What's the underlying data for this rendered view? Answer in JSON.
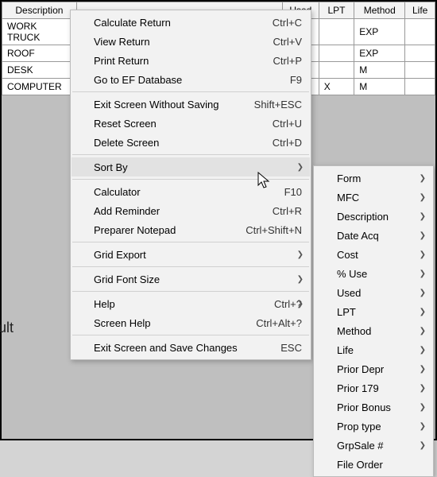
{
  "grid": {
    "headers": [
      "Description",
      "Used",
      "LPT",
      "Method",
      "Life"
    ],
    "rows": [
      {
        "desc": "WORK TRUCK",
        "used": "",
        "lpt": "",
        "method": "EXP",
        "life": ""
      },
      {
        "desc": "ROOF",
        "used": "",
        "lpt": "",
        "method": "EXP",
        "life": ""
      },
      {
        "desc": "DESK",
        "used": "",
        "lpt": "",
        "method": "M",
        "life": ""
      },
      {
        "desc": "COMPUTER",
        "used": "",
        "lpt": "X",
        "method": "M",
        "life": ""
      }
    ]
  },
  "sidebar_fragment": "ult",
  "main_menu": [
    {
      "label": "Calculate Return",
      "shortcut": "Ctrl+C"
    },
    {
      "label": "View Return",
      "shortcut": "Ctrl+V"
    },
    {
      "label": "Print Return",
      "shortcut": "Ctrl+P"
    },
    {
      "label": "Go to EF Database",
      "shortcut": "F9"
    },
    {
      "sep": true
    },
    {
      "label": "Exit Screen Without Saving",
      "shortcut": "Shift+ESC"
    },
    {
      "label": "Reset Screen",
      "shortcut": "Ctrl+U"
    },
    {
      "label": "Delete Screen",
      "shortcut": "Ctrl+D"
    },
    {
      "sep": true
    },
    {
      "label": "Sort By",
      "shortcut": "",
      "submenu": true,
      "hover": true
    },
    {
      "sep": true
    },
    {
      "label": "Calculator",
      "shortcut": "F10"
    },
    {
      "label": "Add Reminder",
      "shortcut": "Ctrl+R"
    },
    {
      "label": "Preparer Notepad",
      "shortcut": "Ctrl+Shift+N"
    },
    {
      "sep": true
    },
    {
      "label": "Grid Export",
      "shortcut": "",
      "submenu": true
    },
    {
      "sep": true
    },
    {
      "label": "Grid Font Size",
      "shortcut": "",
      "submenu": true
    },
    {
      "sep": true
    },
    {
      "label": "Help",
      "shortcut": "Ctrl+?",
      "submenu": true
    },
    {
      "label": "Screen Help",
      "shortcut": "Ctrl+Alt+?"
    },
    {
      "sep": true
    },
    {
      "label": "Exit Screen and Save Changes",
      "shortcut": "ESC"
    }
  ],
  "sub_menu": [
    {
      "label": "Form",
      "submenu": true
    },
    {
      "label": "MFC",
      "submenu": true
    },
    {
      "label": "Description",
      "submenu": true
    },
    {
      "label": "Date Acq",
      "submenu": true
    },
    {
      "label": "Cost",
      "submenu": true
    },
    {
      "label": "% Use",
      "submenu": true
    },
    {
      "label": "Used",
      "submenu": true
    },
    {
      "label": "LPT",
      "submenu": true
    },
    {
      "label": "Method",
      "submenu": true
    },
    {
      "label": "Life",
      "submenu": true
    },
    {
      "label": "Prior Depr",
      "submenu": true
    },
    {
      "label": "Prior 179",
      "submenu": true
    },
    {
      "label": "Prior Bonus",
      "submenu": true
    },
    {
      "label": "Prop type",
      "submenu": true
    },
    {
      "label": "GrpSale #",
      "submenu": true
    },
    {
      "label": "File Order"
    }
  ]
}
